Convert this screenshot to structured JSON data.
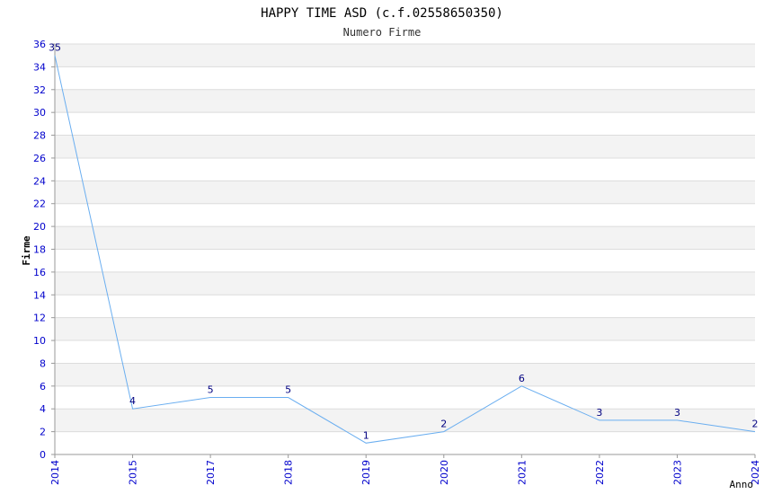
{
  "title": "HAPPY TIME ASD (c.f.02558650350)",
  "subtitle": "Numero Firme",
  "chart_data": {
    "type": "line",
    "title": "HAPPY TIME ASD (c.f.02558650350)",
    "subtitle": "Numero Firme",
    "xlabel": "Anno",
    "ylabel": "Firme",
    "categories": [
      "2014",
      "2015",
      "2017",
      "2018",
      "2019",
      "2020",
      "2021",
      "2022",
      "2023",
      "2024"
    ],
    "values": [
      35,
      4,
      5,
      5,
      1,
      2,
      6,
      3,
      3,
      2
    ],
    "ylim": [
      0,
      36
    ],
    "yticks": [
      0,
      2,
      4,
      6,
      8,
      10,
      12,
      14,
      16,
      18,
      20,
      22,
      24,
      26,
      28,
      30,
      32,
      34,
      36
    ],
    "grid": true,
    "colors": {
      "line": "#6aaef0",
      "tick_labels": "#0000cc",
      "data_labels": "#000080",
      "band": "#f3f3f3",
      "grid": "#dcdcdc"
    }
  }
}
